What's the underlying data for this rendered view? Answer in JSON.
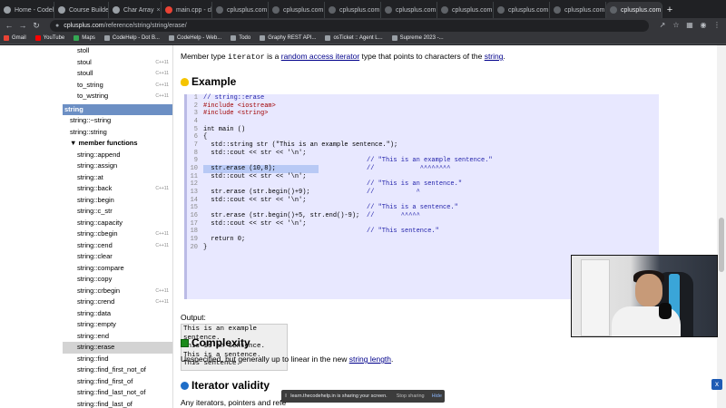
{
  "browser": {
    "tabs": [
      {
        "label": "Home - Codel",
        "icon": "github-icon",
        "active": false
      },
      {
        "label": "Course Builder",
        "icon": "github-icon",
        "active": false
      },
      {
        "label": "Char Array",
        "icon": "github-icon",
        "active": false
      },
      {
        "label": "main.cpp - ch",
        "icon": "red-icon",
        "active": false
      },
      {
        "label": "cplusplus.com",
        "icon": "cpp-icon",
        "active": false
      },
      {
        "label": "cplusplus.com",
        "icon": "cpp-icon",
        "active": false
      },
      {
        "label": "cplusplus.com",
        "icon": "cpp-icon",
        "active": false
      },
      {
        "label": "cplusplus.com",
        "icon": "cpp-icon",
        "active": false
      },
      {
        "label": "cplusplus.com",
        "icon": "cpp-icon",
        "active": false
      },
      {
        "label": "cplusplus.com",
        "icon": "cpp-icon",
        "active": false
      },
      {
        "label": "cplusplus.com",
        "icon": "cpp-icon",
        "active": false
      },
      {
        "label": "cplusplus.com",
        "icon": "cpp-icon",
        "active": true
      }
    ],
    "new_tab": "+",
    "url_host": "cplusplus.com",
    "url_path": "/reference/string/string/erase/",
    "bookmarks": [
      {
        "label": "Gmail",
        "icon": "gmail-icon"
      },
      {
        "label": "YouTube",
        "icon": "youtube-icon"
      },
      {
        "label": "Maps",
        "icon": "maps-icon"
      },
      {
        "label": "CodeHelp - Dot B...",
        "icon": "codehelp-icon"
      },
      {
        "label": "CodeHelp - Web...",
        "icon": "codehelp-icon"
      },
      {
        "label": "Todo",
        "icon": "todo-icon"
      },
      {
        "label": "Graphy REST API...",
        "icon": "graphy-icon"
      },
      {
        "label": "osTicket :: Agent L...",
        "icon": "osticket-icon"
      },
      {
        "label": "Supreme 2023 -...",
        "icon": "supreme-icon"
      }
    ]
  },
  "sidebar": {
    "top_items": [
      {
        "label": "stoll",
        "tag": ""
      },
      {
        "label": "stoul",
        "tag": "C++11"
      },
      {
        "label": "stoull",
        "tag": "C++11"
      },
      {
        "label": "to_string",
        "tag": "C++11"
      },
      {
        "label": "to_wstring",
        "tag": "C++11"
      }
    ],
    "section": "string",
    "class_items": [
      {
        "label": "string::~string",
        "tag": ""
      },
      {
        "label": "string::string",
        "tag": ""
      }
    ],
    "group_head": "member functions",
    "members": [
      {
        "label": "string::append",
        "tag": "",
        "active": false
      },
      {
        "label": "string::assign",
        "tag": "",
        "active": false
      },
      {
        "label": "string::at",
        "tag": "",
        "active": false
      },
      {
        "label": "string::back",
        "tag": "C++11",
        "active": false
      },
      {
        "label": "string::begin",
        "tag": "",
        "active": false
      },
      {
        "label": "string::c_str",
        "tag": "",
        "active": false
      },
      {
        "label": "string::capacity",
        "tag": "",
        "active": false
      },
      {
        "label": "string::cbegin",
        "tag": "C++11",
        "active": false
      },
      {
        "label": "string::cend",
        "tag": "C++11",
        "active": false
      },
      {
        "label": "string::clear",
        "tag": "",
        "active": false
      },
      {
        "label": "string::compare",
        "tag": "",
        "active": false
      },
      {
        "label": "string::copy",
        "tag": "",
        "active": false
      },
      {
        "label": "string::crbegin",
        "tag": "C++11",
        "active": false
      },
      {
        "label": "string::crend",
        "tag": "C++11",
        "active": false
      },
      {
        "label": "string::data",
        "tag": "",
        "active": false
      },
      {
        "label": "string::empty",
        "tag": "",
        "active": false
      },
      {
        "label": "string::end",
        "tag": "",
        "active": false
      },
      {
        "label": "string::erase",
        "tag": "",
        "active": true
      },
      {
        "label": "string::find",
        "tag": "",
        "active": false
      },
      {
        "label": "string::find_first_not_of",
        "tag": "",
        "active": false
      },
      {
        "label": "string::find_first_of",
        "tag": "",
        "active": false
      },
      {
        "label": "string::find_last_not_of",
        "tag": "",
        "active": false
      },
      {
        "label": "string::find_last_of",
        "tag": "",
        "active": false
      }
    ]
  },
  "content": {
    "member_type_pre": "Member type ",
    "member_type_code": "iterator",
    "member_type_mid": " is a ",
    "member_type_link": "random access iterator",
    "member_type_post": " type that points to characters of the ",
    "member_type_link2": "string",
    "member_type_end": ".",
    "example_heading": "Example",
    "code_lines": [
      {
        "n": "1",
        "text": "// string::erase",
        "cls": "cm",
        "right": ""
      },
      {
        "n": "2",
        "text": "#include <iostream>",
        "cls": "pp",
        "right": ""
      },
      {
        "n": "3",
        "text": "#include <string>",
        "cls": "pp",
        "right": ""
      },
      {
        "n": "4",
        "text": "",
        "cls": "",
        "right": ""
      },
      {
        "n": "5",
        "text": "int main ()",
        "cls": "",
        "right": ""
      },
      {
        "n": "6",
        "text": "{",
        "cls": "",
        "right": ""
      },
      {
        "n": "7",
        "text": "  std::string str (\"This is an example sentence.\");",
        "cls": "",
        "right": ""
      },
      {
        "n": "8",
        "text": "  std::cout << str << '\\n';",
        "cls": "",
        "right": ""
      },
      {
        "n": "9",
        "text": "",
        "cls": "",
        "right": "// \"This is an example sentence.\""
      },
      {
        "n": "10",
        "text": "  str.erase (10,8);",
        "cls": "",
        "right": "//            ^^^^^^^^",
        "hl": true
      },
      {
        "n": "11",
        "text": "  std::cout << str << '\\n';",
        "cls": "",
        "right": ""
      },
      {
        "n": "12",
        "text": "",
        "cls": "",
        "right": "// \"This is an sentence.\""
      },
      {
        "n": "13",
        "text": "  str.erase (str.begin()+9);",
        "cls": "",
        "right": "//           ^"
      },
      {
        "n": "14",
        "text": "  std::cout << str << '\\n';",
        "cls": "",
        "right": ""
      },
      {
        "n": "15",
        "text": "",
        "cls": "",
        "right": "// \"This is a sentence.\""
      },
      {
        "n": "16",
        "text": "  str.erase (str.begin()+5, str.end()-9);",
        "cls": "",
        "right": "//       ^^^^^"
      },
      {
        "n": "17",
        "text": "  std::cout << str << '\\n';",
        "cls": "",
        "right": ""
      },
      {
        "n": "18",
        "text": "",
        "cls": "",
        "right": "// \"This sentence.\""
      },
      {
        "n": "19",
        "text": "  return 0;",
        "cls": "",
        "right": ""
      },
      {
        "n": "20",
        "text": "}",
        "cls": "",
        "right": ""
      }
    ],
    "output_label": "Output:",
    "output_lines": [
      "This is an example sentence.",
      "This is an sentence.",
      "This is a sentence.",
      "This sentence."
    ],
    "complexity_heading": "Complexity",
    "complexity_pre": "Unspecified, but generally up to linear in the new ",
    "complexity_link": "string length",
    "complexity_end": ".",
    "iterator_heading": "Iterator validity",
    "iterator_pre": "Any iterators, pointers and refe"
  },
  "share_bar": {
    "text": "learn.thecodehelp.in is sharing your screen.",
    "stop": "Stop sharing",
    "hide": "Hide"
  },
  "close_button": "x"
}
